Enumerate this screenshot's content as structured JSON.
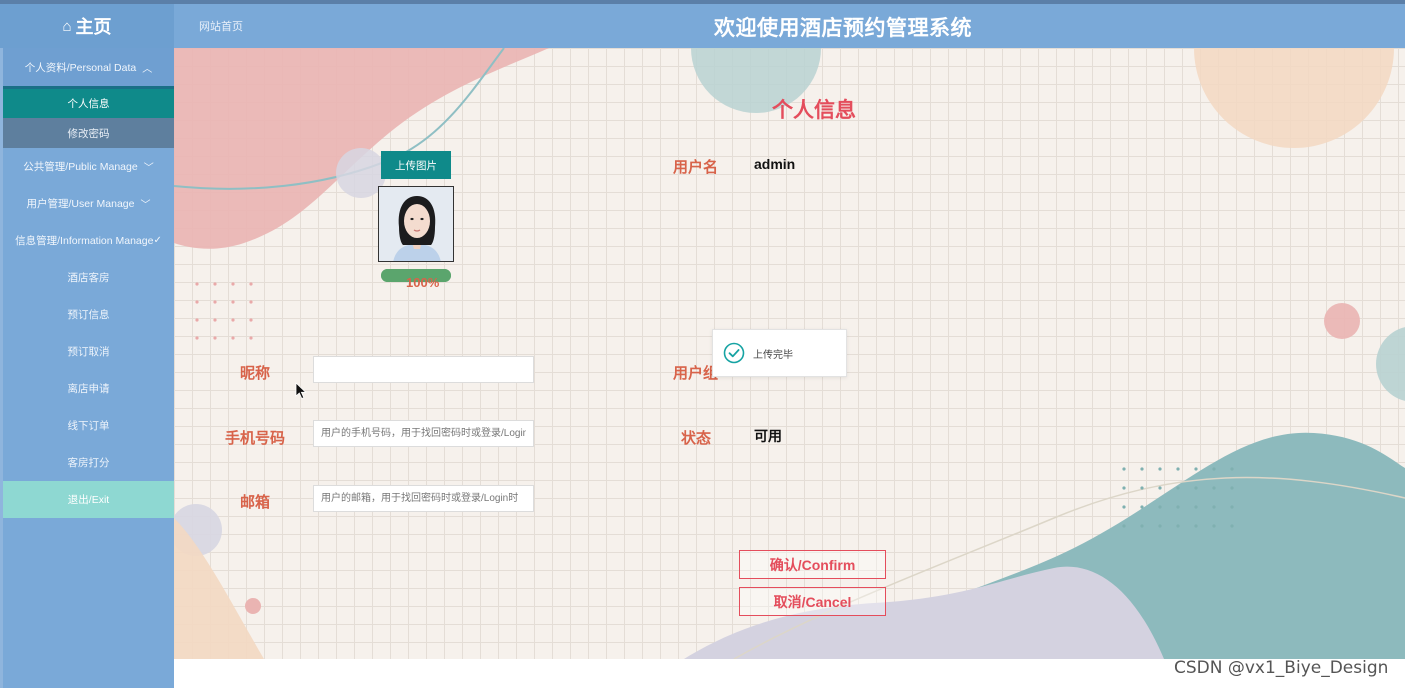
{
  "header": {
    "brand": "主页",
    "home_link": "网站首页",
    "system_title": "欢迎使用酒店预约管理系统"
  },
  "sidebar": {
    "personal_group": "个人资料/Personal Data",
    "personal_items": [
      "个人信息",
      "修改密码"
    ],
    "public_group": "公共管理/Public Manage",
    "user_group": "用户管理/User Manage",
    "info_group": "信息管理/Information Manage",
    "info_items": [
      "酒店客房",
      "预订信息",
      "预订取消",
      "离店申请",
      "线下订单",
      "客房打分"
    ],
    "exit_label": "退出/Exit"
  },
  "profile": {
    "page_title": "个人信息",
    "upload_button": "上传图片",
    "upload_progress_text": "100%",
    "upload_progress": 1.0,
    "username_label": "用户名",
    "username_value": "admin",
    "nickname_label": "昵称",
    "nickname_value": "",
    "user_group_label": "用户组",
    "phone_label": "手机号码",
    "phone_placeholder": "用户的手机号码，用于找回密码时或登录/Login时",
    "status_label": "状态",
    "status_value": "可用",
    "email_label": "邮箱",
    "email_placeholder": "用户的邮箱，用于找回密码时或登录/Login时",
    "confirm_button": "确认/Confirm",
    "cancel_button": "取消/Cancel"
  },
  "toast": {
    "icon": "check-circle-icon",
    "message": "上传完毕"
  },
  "watermark": "CSDN @vx1_Biye_Design",
  "colors": {
    "header_bg": "#7aa9d8",
    "active_teal": "#0f8a8a",
    "exit_bg": "#8ed8d2",
    "label_orange": "#d8634a",
    "accent_red": "#e44d5c"
  }
}
